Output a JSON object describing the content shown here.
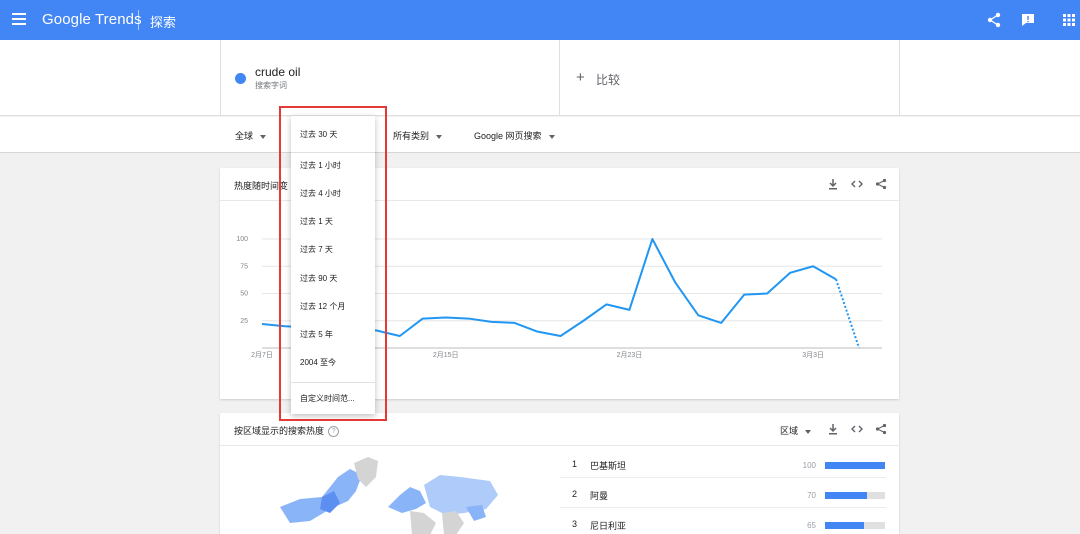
{
  "topbar": {
    "brand": "Google Trends",
    "explore": "探索",
    "icons": [
      "menu-icon",
      "share-icon",
      "feedback-icon",
      "apps-grid-icon"
    ]
  },
  "search": {
    "term": "crude oil",
    "term_type": "搜索字词",
    "compare_label": "比较"
  },
  "filters": {
    "region": "全球",
    "category": "所有类别",
    "property": "Google 网页搜索"
  },
  "interest_card": {
    "title": "热度随时间变",
    "icons": [
      "download-icon",
      "embed-icon",
      "share-icon"
    ]
  },
  "region_card": {
    "title": "按区域显示的搜索热度",
    "dropdown_label": "区域",
    "rows": [
      {
        "rank": "1",
        "name": "巴基斯坦",
        "value": "100",
        "fraction": 1.0
      },
      {
        "rank": "2",
        "name": "阿曼",
        "value": "70",
        "fraction": 0.7
      },
      {
        "rank": "3",
        "name": "尼日利亚",
        "value": "65",
        "fraction": 0.65
      }
    ]
  },
  "time_dropdown": {
    "selected": "过去 30 天",
    "options": [
      "过去 1 小时",
      "过去 4 小时",
      "过去 1 天",
      "过去 7 天",
      "过去 90 天",
      "过去 12 个月",
      "过去 5 年",
      "2004 至今"
    ],
    "custom": "自定义时间范..."
  },
  "colors": {
    "accent": "#4285f4",
    "line": "#2196f3",
    "highlight": "#e53935"
  },
  "chart_data": {
    "type": "line",
    "ylim": [
      0,
      100
    ],
    "yticks": [
      "25",
      "50",
      "75",
      "100"
    ],
    "xtick_labels": [
      "2月7日",
      "2月15日",
      "2月23日",
      "3月3日"
    ],
    "xtick_index": [
      0,
      8,
      16,
      24
    ],
    "x": [
      "2月7日",
      "2月8日",
      "2月9日",
      "2月10日",
      "2月11日",
      "2月12日",
      "2月13日",
      "2月14日",
      "2月15日",
      "2月16日",
      "2月17日",
      "2月18日",
      "2月19日",
      "2月20日",
      "2月21日",
      "2月22日",
      "2月23日",
      "2月24日",
      "2月25日",
      "2月26日",
      "2月27日",
      "2月28日",
      "3月1日",
      "3月2日",
      "3月3日",
      "3月4日",
      "3月5日",
      "3月6日"
    ],
    "values": [
      22,
      20,
      19,
      18,
      17,
      16,
      11,
      27,
      28,
      27,
      24,
      23,
      15,
      11,
      25,
      40,
      35,
      100,
      60,
      30,
      23,
      49,
      50,
      69,
      75,
      63,
      0
    ],
    "partial_from_index": 25
  }
}
